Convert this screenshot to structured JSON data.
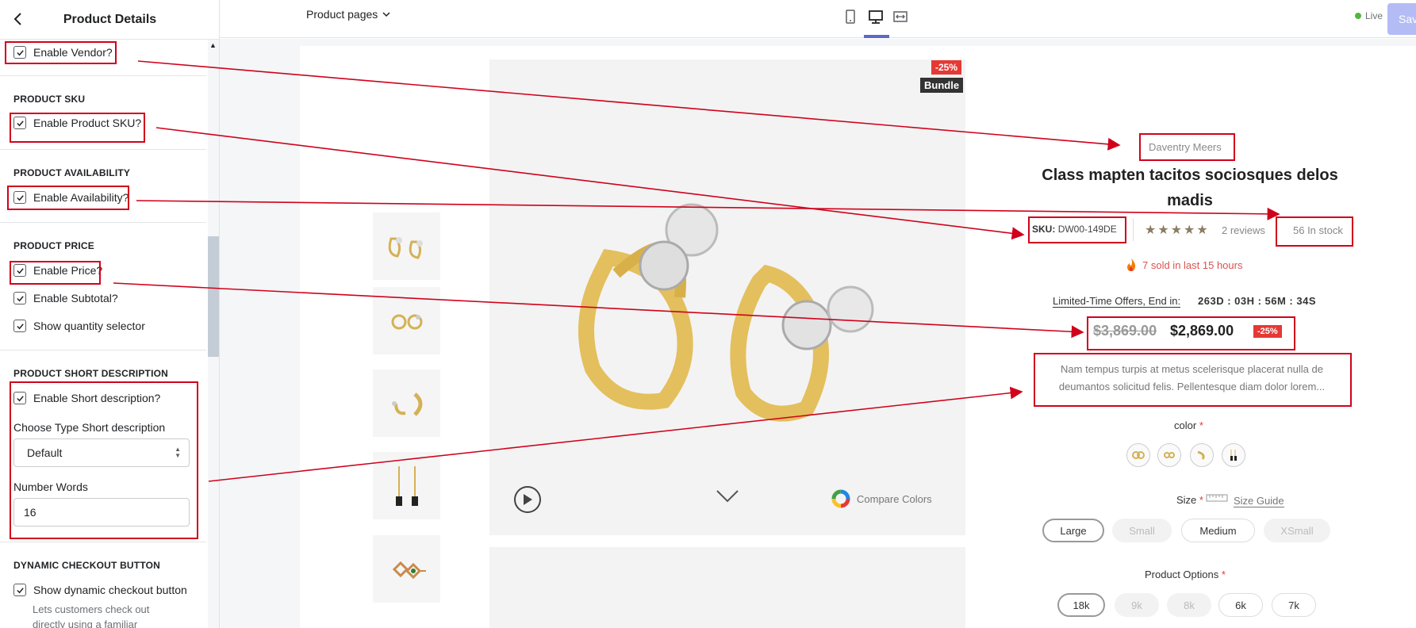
{
  "sidebar": {
    "title": "Product Details",
    "sections": {
      "vendor": {
        "checkbox": "Enable Vendor?"
      },
      "sku": {
        "heading": "PRODUCT SKU",
        "checkbox": "Enable Product SKU?"
      },
      "availability": {
        "heading": "PRODUCT AVAILABILITY",
        "checkbox": "Enable Availability?"
      },
      "price": {
        "heading": "PRODUCT PRICE",
        "checkbox_price": "Enable Price?",
        "checkbox_subtotal": "Enable Subtotal?",
        "checkbox_qty": "Show quantity selector"
      },
      "short_desc": {
        "heading": "PRODUCT SHORT DESCRIPTION",
        "checkbox": "Enable Short description?",
        "type_label": "Choose Type Short description",
        "type_value": "Default",
        "words_label": "Number Words",
        "words_value": "16"
      },
      "checkout": {
        "heading": "DYNAMIC CHECKOUT BUTTON",
        "checkbox": "Show dynamic checkout button",
        "help": "Lets customers check out directly using a familiar"
      }
    }
  },
  "topbar": {
    "page_select": "Product pages",
    "live": "Live",
    "save": "Sav"
  },
  "product": {
    "badge_sale": "-25%",
    "badge_bundle": "Bundle",
    "compare": "Compare Colors",
    "vendor": "Daventry Meers",
    "title": "Class mapten tacitos sociosques delos madis",
    "sku_label": "SKU:",
    "sku_value": "DW00-149DE",
    "stars": "★★★★★",
    "reviews": "2 reviews",
    "stock": "56 In stock",
    "sold": "7 sold in last 15 hours",
    "countdown_label": "Limited-Time Offers, End in:",
    "countdown": "263D : 03H : 56M : 34S",
    "old_price": "$3,869.00",
    "new_price": "$2,869.00",
    "price_badge": "-25%",
    "description": "Nam tempus turpis at metus scelerisque placerat nulla de deumantos solicitud felis. Pellentesque diam dolor lorem...",
    "color_label": "color",
    "size_label": "Size",
    "size_guide": "Size Guide",
    "sizes": [
      "Large",
      "Small",
      "Medium",
      "XSmall"
    ],
    "options_label": "Product Options",
    "options": [
      "18k",
      "9k",
      "8k",
      "6k",
      "7k"
    ],
    "required": "*"
  },
  "colors": {
    "accent": "#5c6ac4",
    "annotation": "#d0021b",
    "sale": "#e53935",
    "live": "#50b83c"
  }
}
